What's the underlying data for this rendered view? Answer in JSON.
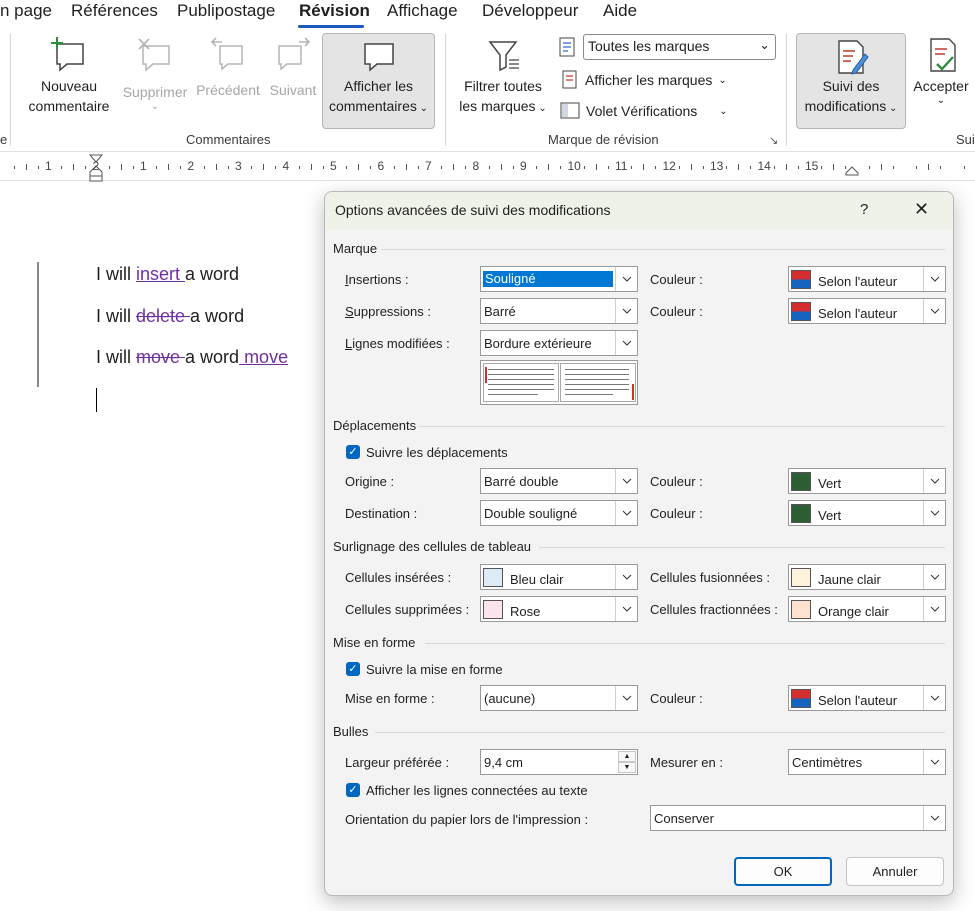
{
  "ribbon_tabs": {
    "items": [
      "n page",
      "Références",
      "Publipostage",
      "Révision",
      "Affichage",
      "Développeur",
      "Aide"
    ],
    "active": "Révision"
  },
  "ribbon": {
    "edge_label_left": "e",
    "edge_label_right": "Sui",
    "comments": {
      "new_line1": "Nouveau",
      "new_line2": "commentaire",
      "delete": "Supprimer",
      "previous": "Précédent",
      "next": "Suivant",
      "show_line1": "Afficher les",
      "show_line2": "commentaires",
      "group_label": "Commentaires"
    },
    "markup": {
      "filter_line1": "Filtrer toutes",
      "filter_line2": "les marques",
      "display_combo": "Toutes les marques",
      "show_markup": "Afficher les marques",
      "reviewing_pane": "Volet Vérifications",
      "group_label": "Marque de révision"
    },
    "tracking": {
      "track_line1": "Suivi des",
      "track_line2": "modifications",
      "accept": "Accepter"
    }
  },
  "ruler": {
    "numbers": [
      "1",
      "2",
      "1",
      "2",
      "3",
      "4",
      "5",
      "6",
      "7",
      "8",
      "9",
      "10",
      "11",
      "12",
      "13",
      "14",
      "15"
    ]
  },
  "document": {
    "line1": {
      "prefix": "I will ",
      "inserted": "insert ",
      "suffix": "a word"
    },
    "line2": {
      "prefix": "I will ",
      "deleted": "delete ",
      "suffix": "a word"
    },
    "line3": {
      "prefix": "I will ",
      "deleted": "move ",
      "middle": "a word",
      "inserted": " move"
    }
  },
  "dialog": {
    "title": "Options avancées de suivi des modifications",
    "help": "?",
    "close": "✕",
    "sections": {
      "marque": "Marque",
      "deplacements": "Déplacements",
      "surlignage": "Surlignage des cellules de tableau",
      "mise_en_forme": "Mise en forme",
      "bulles": "Bulles"
    },
    "marque": {
      "insertions_label": "Insertions :",
      "insertions_value": "Souligné",
      "suppressions_label": "Suppressions :",
      "suppressions_value": "Barré",
      "lignes_label": "Lignes modifiées :",
      "lignes_value": "Bordure extérieure",
      "couleur_label": "Couleur :",
      "couleur1_value": "Selon l'auteur",
      "couleur2_value": "Selon l'auteur"
    },
    "deplacements": {
      "checkbox": "Suivre les déplacements",
      "origine_label": "Origine :",
      "origine_value": "Barré double",
      "destination_label": "Destination :",
      "destination_value": "Double souligné",
      "couleur_label": "Couleur :",
      "couleur1_value": "Vert",
      "couleur2_value": "Vert"
    },
    "surlignage": {
      "inserees_label": "Cellules insérées :",
      "inserees_value": "Bleu clair",
      "supprimees_label": "Cellules supprimées :",
      "supprimees_value": "Rose",
      "fusionnees_label": "Cellules fusionnées :",
      "fusionnees_value": "Jaune clair",
      "fractionnees_label": "Cellules fractionnées :",
      "fractionnees_value": "Orange clair"
    },
    "mise_en_forme": {
      "checkbox": "Suivre la mise en forme",
      "label": "Mise en forme :",
      "value": "(aucune)",
      "couleur_label": "Couleur :",
      "couleur_value": "Selon l'auteur"
    },
    "bulles": {
      "largeur_label": "Largeur préférée :",
      "largeur_value": "9,4 cm",
      "mesurer_label": "Mesurer en :",
      "mesurer_value": "Centimètres",
      "checkbox": "Afficher les lignes connectées au texte",
      "orientation_label": "Orientation du papier lors de l'impression :",
      "orientation_value": "Conserver"
    },
    "ok": "OK",
    "cancel": "Annuler"
  },
  "colors": {
    "accent": "#185abd",
    "revision_purple": "#7030a0",
    "author_red": "#d32f2f",
    "author_blue": "#1565c0",
    "green": "#2e5e34",
    "light_blue": "#ddebf7",
    "pink": "#fce4ef",
    "light_yellow": "#fdf2dc",
    "light_orange": "#fde3cf"
  }
}
